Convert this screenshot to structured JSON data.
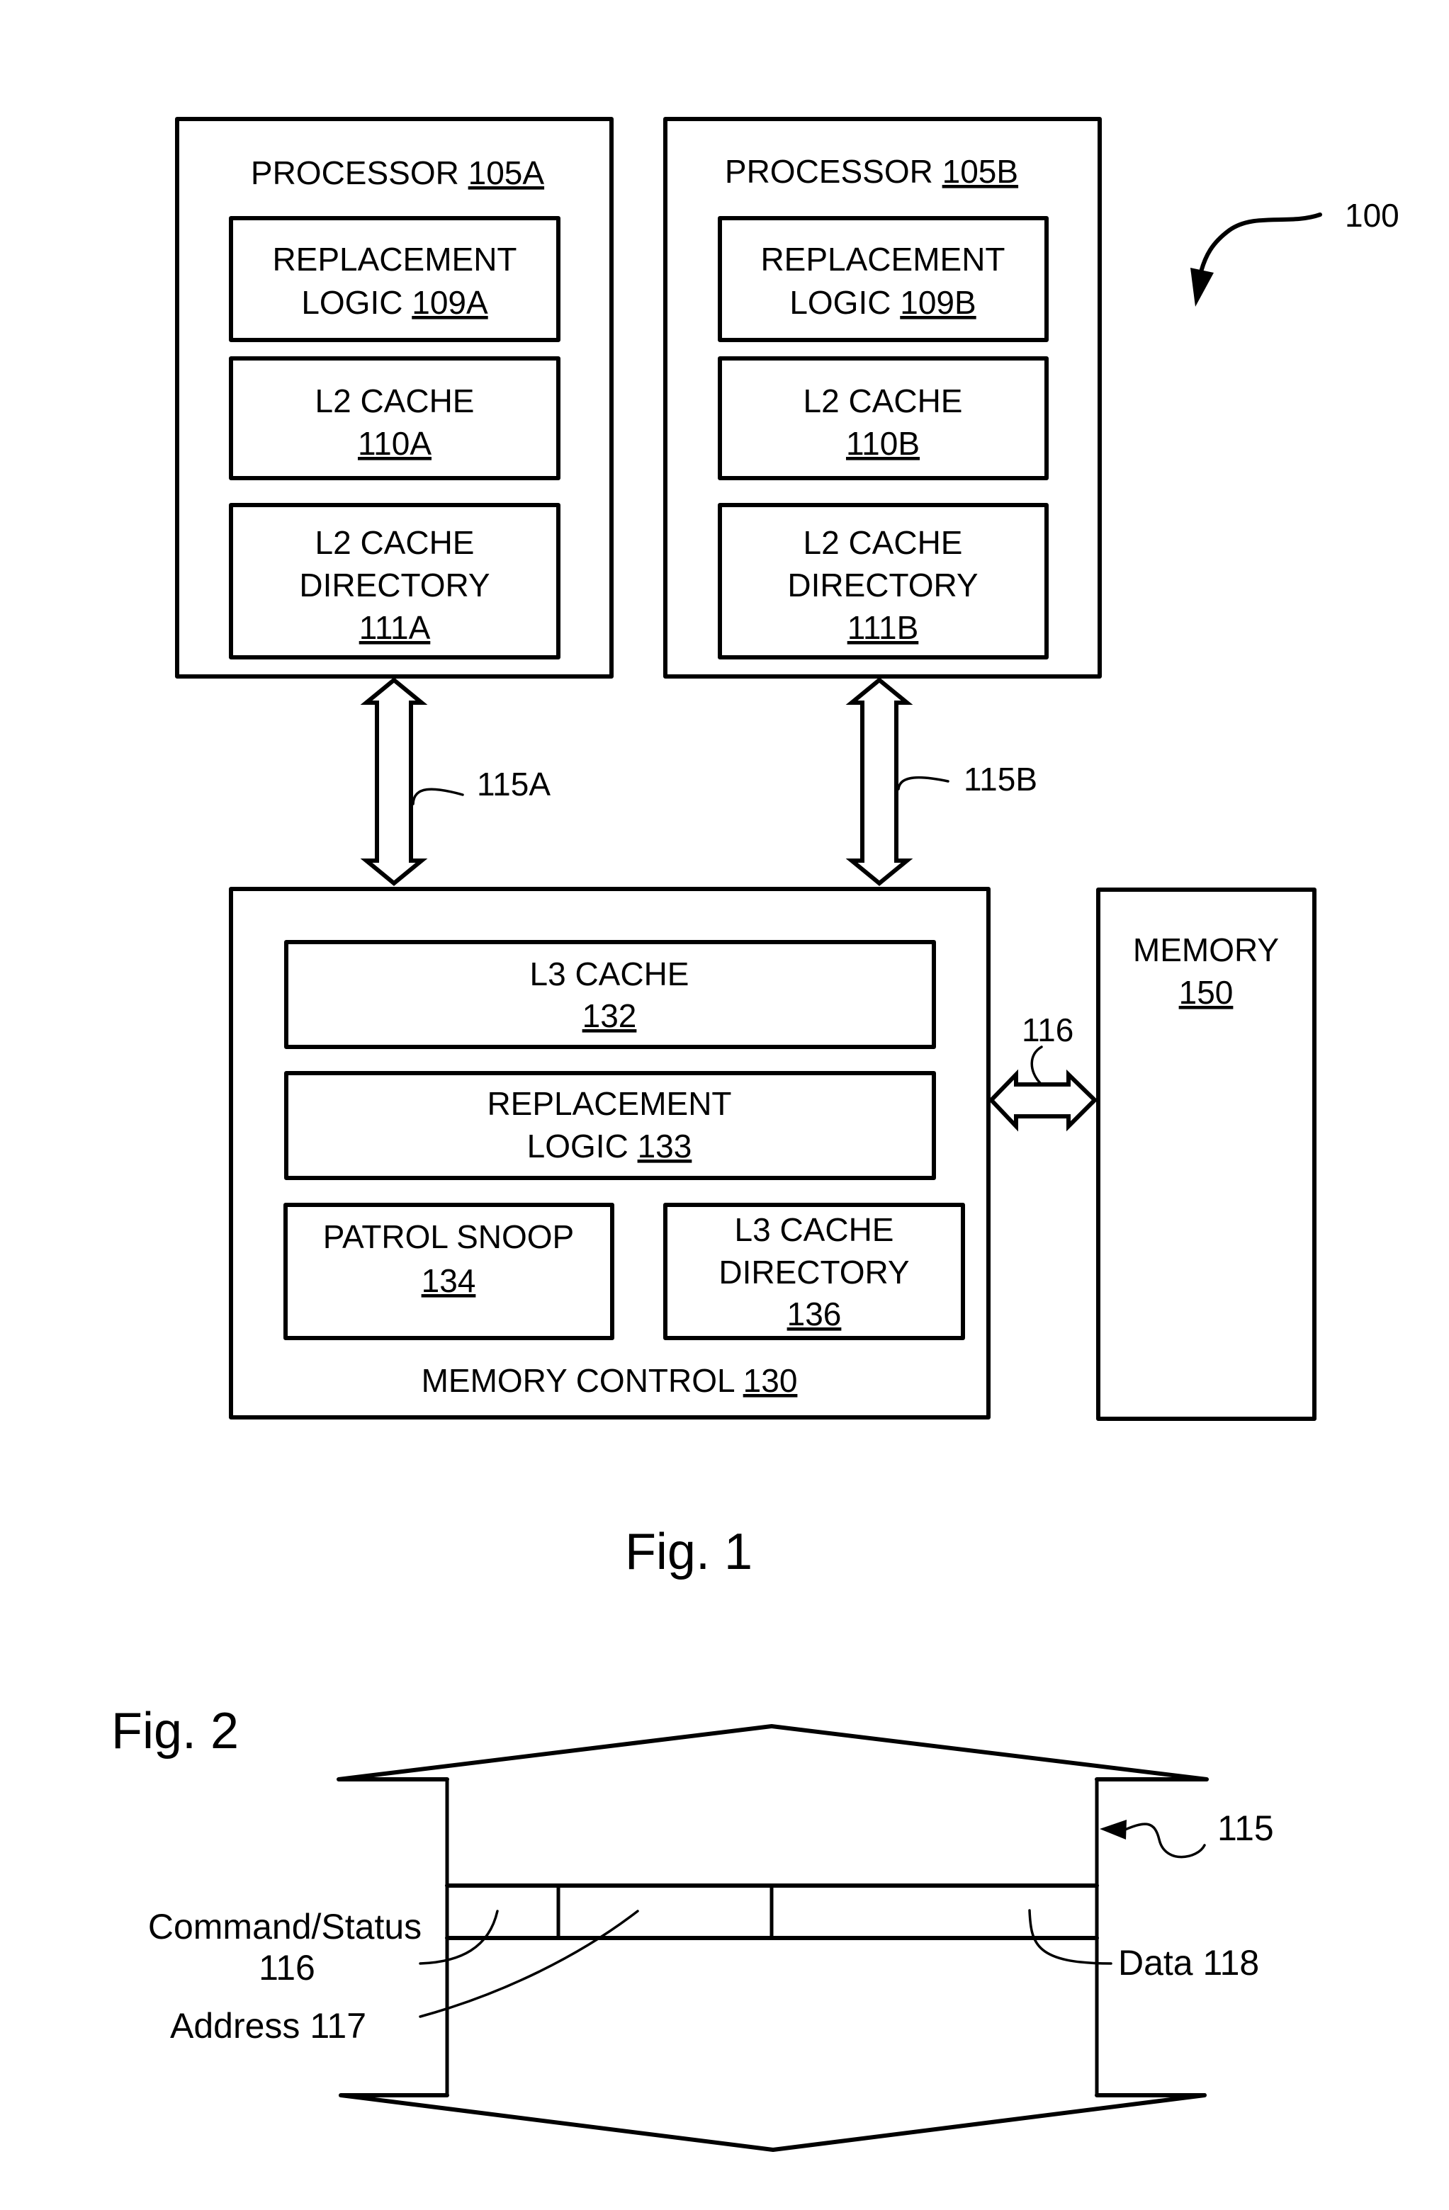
{
  "figure1": {
    "caption": "Fig. 1",
    "system_ref": "100",
    "processor_a": {
      "title": "PROCESSOR ",
      "ref": "105A",
      "replacement": {
        "line1": "REPLACEMENT",
        "line2": "LOGIC ",
        "ref": "109A"
      },
      "l2_cache": {
        "line1": "L2 CACHE",
        "ref": "110A"
      },
      "l2_directory": {
        "line1": "L2 CACHE",
        "line2": "DIRECTORY",
        "ref": "111A"
      }
    },
    "processor_b": {
      "title": "PROCESSOR ",
      "ref": "105B",
      "replacement": {
        "line1": "REPLACEMENT",
        "line2": "LOGIC ",
        "ref": "109B"
      },
      "l2_cache": {
        "line1": "L2 CACHE",
        "ref": "110B"
      },
      "l2_directory": {
        "line1": "L2 CACHE",
        "line2": "DIRECTORY",
        "ref": "111B"
      }
    },
    "bus_a_label": "115A",
    "bus_b_label": "115B",
    "memory_bus_label": "116",
    "memory_control": {
      "title": "MEMORY CONTROL ",
      "ref": "130",
      "l3_cache": {
        "line1": "L3 CACHE",
        "ref": "132"
      },
      "replacement": {
        "line1": "REPLACEMENT",
        "line2": "LOGIC ",
        "ref": "133"
      },
      "patrol_snoop": {
        "line1": "PATROL SNOOP",
        "ref": "134"
      },
      "l3_directory": {
        "line1": "L3 CACHE",
        "line2": "DIRECTORY",
        "ref": "136"
      }
    },
    "memory": {
      "title": "MEMORY",
      "ref": "150"
    }
  },
  "figure2": {
    "caption": "Fig. 2",
    "bus_ref": "115",
    "command_status": {
      "line1": "Command/Status",
      "line2": "116"
    },
    "address": "Address 117",
    "data": "Data 118"
  }
}
